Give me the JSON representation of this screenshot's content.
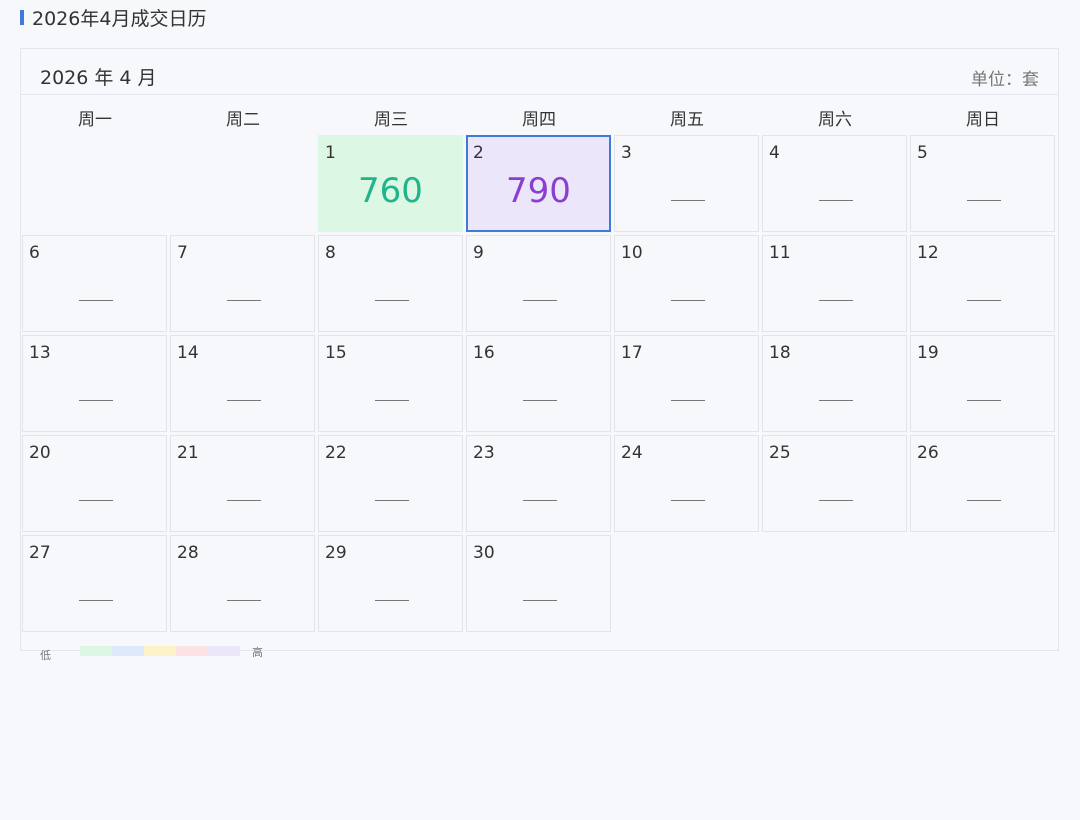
{
  "page": {
    "title": "2026年4月成交日历"
  },
  "calendar": {
    "month_label": "2026 年 4 月",
    "unit_label": "单位：套",
    "weekdays": [
      "周一",
      "周二",
      "周三",
      "周四",
      "周五",
      "周六",
      "周日"
    ],
    "empty_value_label": "——",
    "days": [
      {
        "day": "1",
        "value": "760",
        "color": "#21b48a",
        "bg": "#dcf8e4"
      },
      {
        "day": "2",
        "value": "790",
        "color": "#8a3fd1",
        "bg": "#ece6fb",
        "selected": true
      },
      {
        "day": "3",
        "value": null
      },
      {
        "day": "4",
        "value": null
      },
      {
        "day": "5",
        "value": null
      },
      {
        "day": "6",
        "value": null
      },
      {
        "day": "7",
        "value": null
      },
      {
        "day": "8",
        "value": null
      },
      {
        "day": "9",
        "value": null
      },
      {
        "day": "10",
        "value": null
      },
      {
        "day": "11",
        "value": null
      },
      {
        "day": "12",
        "value": null
      },
      {
        "day": "13",
        "value": null
      },
      {
        "day": "14",
        "value": null
      },
      {
        "day": "15",
        "value": null
      },
      {
        "day": "16",
        "value": null
      },
      {
        "day": "17",
        "value": null
      },
      {
        "day": "18",
        "value": null
      },
      {
        "day": "19",
        "value": null
      },
      {
        "day": "20",
        "value": null
      },
      {
        "day": "21",
        "value": null
      },
      {
        "day": "22",
        "value": null
      },
      {
        "day": "23",
        "value": null
      },
      {
        "day": "24",
        "value": null
      },
      {
        "day": "25",
        "value": null
      },
      {
        "day": "26",
        "value": null
      },
      {
        "day": "27",
        "value": null
      },
      {
        "day": "28",
        "value": null
      },
      {
        "day": "29",
        "value": null
      },
      {
        "day": "30",
        "value": null
      }
    ],
    "first_weekday_index": 2
  },
  "legend": {
    "low_label": "低",
    "high_label": "高",
    "colors": [
      "#dcf8e4",
      "#dde9fb",
      "#fdf3c9",
      "#fde2e4",
      "#ece6fb"
    ]
  },
  "colors": {
    "accent": "#3e7bd6"
  }
}
